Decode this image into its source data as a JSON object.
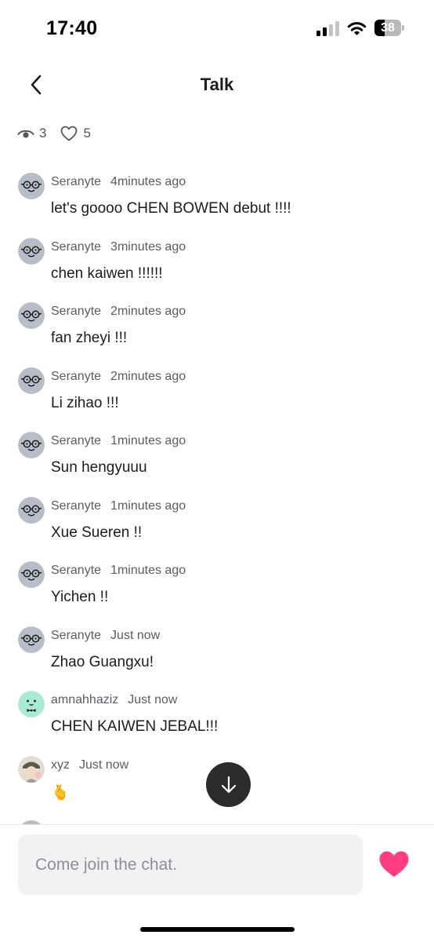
{
  "status_bar": {
    "time": "17:40",
    "battery_level": "38",
    "battery_fraction": 0.38
  },
  "header": {
    "title": "Talk",
    "back_icon": "chevron-left-icon"
  },
  "stats": {
    "views": "3",
    "likes": "5",
    "views_icon": "eye-icon",
    "likes_icon": "heart-outline-icon"
  },
  "messages": [
    {
      "user": "Seranyte",
      "time": "4minutes ago",
      "text": "let's goooo CHEN BOWEN debut !!!!",
      "avatar": "glasses-face"
    },
    {
      "user": "Seranyte",
      "time": "3minutes ago",
      "text": "chen kaiwen !!!!!!",
      "avatar": "glasses-face"
    },
    {
      "user": "Seranyte",
      "time": "2minutes ago",
      "text": "fan zheyi !!!",
      "avatar": "glasses-face"
    },
    {
      "user": "Seranyte",
      "time": "2minutes ago",
      "text": "Li zihao !!!",
      "avatar": "glasses-face"
    },
    {
      "user": "Seranyte",
      "time": "1minutes ago",
      "text": "Sun hengyuuu",
      "avatar": "glasses-face"
    },
    {
      "user": "Seranyte",
      "time": "1minutes ago",
      "text": "Xue Sueren !!",
      "avatar": "glasses-face"
    },
    {
      "user": "Seranyte",
      "time": "1minutes ago",
      "text": "Yichen !!",
      "avatar": "glasses-face"
    },
    {
      "user": "Seranyte",
      "time": "Just now",
      "text": "Zhao Guangxu!",
      "avatar": "glasses-face"
    },
    {
      "user": "amnahhaziz",
      "time": "Just now",
      "text": "CHEN KAIWEN JEBAL!!!",
      "avatar": "bowtie-face"
    },
    {
      "user": "xyz",
      "time": "Just now",
      "text": "🫰",
      "avatar": "photo"
    },
    {
      "user": "",
      "time": "",
      "text": "",
      "avatar": "glasses-face"
    }
  ],
  "composer": {
    "placeholder": "Come join the chat."
  },
  "actions": {
    "scroll_down_icon": "arrow-down-icon",
    "like_icon": "heart-icon"
  },
  "colors": {
    "accent_heart": "#ff3d7f",
    "avatar_gray": "#b8bdca",
    "avatar_mint": "#a8ead5",
    "scroll_button": "#2c2c2e"
  }
}
